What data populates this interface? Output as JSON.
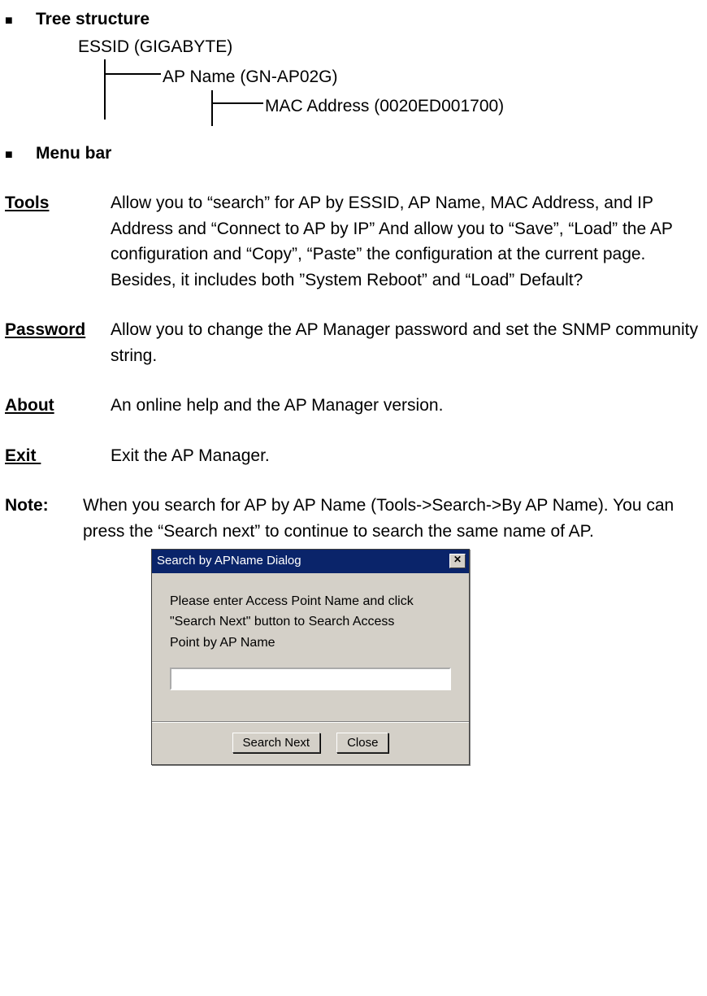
{
  "section1": {
    "title": "Tree structure",
    "essid": "ESSID (GIGABYTE)",
    "apname": "AP Name (GN-AP02G)",
    "mac": "MAC Address (0020ED001700)"
  },
  "section2": {
    "title": "Menu bar"
  },
  "menu": {
    "tools": {
      "label": "Tools",
      "desc": "Allow you to “search” for AP by ESSID, AP Name, MAC Address, and IP Address and “Connect to AP by IP” And allow you to “Save”, “Load” the AP configuration and “Copy”, “Paste” the configuration at the current page. Besides, it includes both ”System Reboot” and “Load” Default?"
    },
    "password": {
      "label": "Password",
      "desc": "Allow you to change the AP Manager password and set the SNMP community string."
    },
    "about": {
      "label": "About",
      "desc": "An online help and the AP Manager version."
    },
    "exit": {
      "label": "Exit",
      "desc": "Exit the AP Manager."
    }
  },
  "note": {
    "label": "Note:",
    "text": "When you search for AP by AP Name (Tools->Search->By AP Name). You can press the “Search next” to continue to search the same name of AP."
  },
  "dialog": {
    "title": "Search by APName Dialog",
    "line1": "Please enter Access Point Name and click",
    "line2": "\"Search Next\" button to Search Access",
    "line3": "Point by AP Name",
    "btn_search": "Search Next",
    "btn_close": "Close",
    "close_x": "✕"
  }
}
